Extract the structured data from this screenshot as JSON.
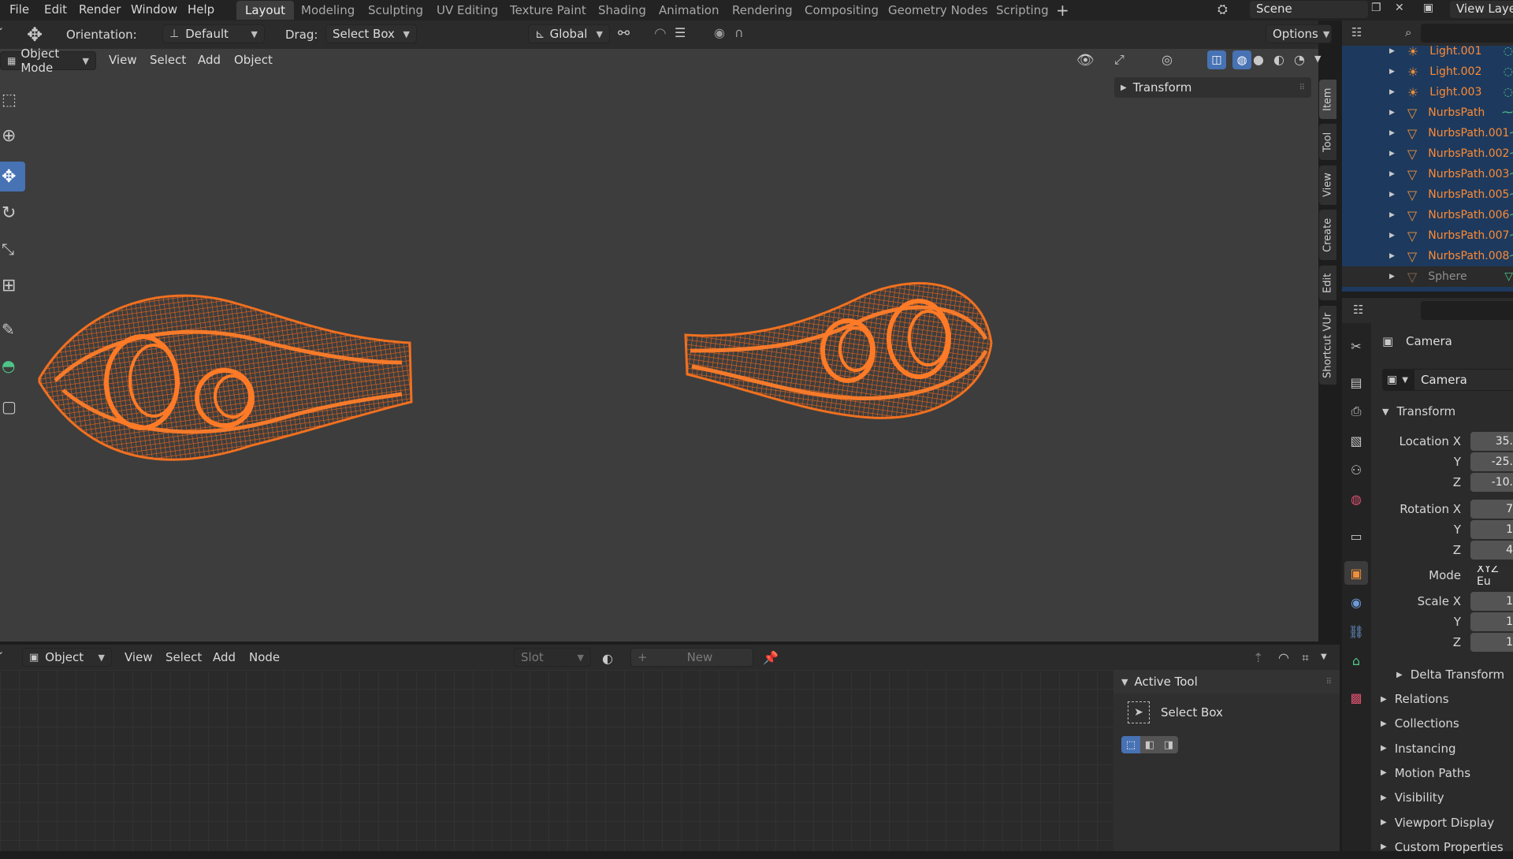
{
  "menu": [
    "File",
    "Edit",
    "Render",
    "Window",
    "Help"
  ],
  "workspaces": [
    "Layout",
    "Modeling",
    "Sculpting",
    "UV Editing",
    "Texture Paint",
    "Shading",
    "Animation",
    "Rendering",
    "Compositing",
    "Geometry Nodes",
    "Scripting"
  ],
  "active_workspace": "Layout",
  "scene_name": "Scene",
  "view_layer": "View Laye",
  "toolheader": {
    "orientation_label": "Orientation:",
    "orientation_value": "Default",
    "drag_label": "Drag:",
    "drag_value": "Select Box",
    "transform_orientation": "Global",
    "options": "Options"
  },
  "viewport_header": {
    "mode": "Object Mode",
    "menus": [
      "View",
      "Select",
      "Add",
      "Object"
    ]
  },
  "npanel": {
    "transform_header": "Transform",
    "tabs": [
      "Item",
      "Tool",
      "View",
      "Create",
      "Edit",
      "Shortcut VUr"
    ]
  },
  "outliner": {
    "rows": [
      {
        "name": "Light.001",
        "type": "light"
      },
      {
        "name": "Light.002",
        "type": "light"
      },
      {
        "name": "Light.003",
        "type": "light"
      },
      {
        "name": "NurbsPath",
        "type": "curve"
      },
      {
        "name": "NurbsPath.001",
        "type": "curve"
      },
      {
        "name": "NurbsPath.002",
        "type": "curve"
      },
      {
        "name": "NurbsPath.003",
        "type": "curve"
      },
      {
        "name": "NurbsPath.005",
        "type": "curve"
      },
      {
        "name": "NurbsPath.006",
        "type": "curve"
      },
      {
        "name": "NurbsPath.007",
        "type": "curve"
      },
      {
        "name": "NurbsPath.008",
        "type": "curve"
      },
      {
        "name": "Sphere",
        "type": "mesh"
      }
    ]
  },
  "properties": {
    "object_name": "Camera",
    "data_name": "Camera",
    "transform_header": "Transform",
    "location_label": "Location X",
    "location": [
      "35.",
      "-25.",
      "-10."
    ],
    "rotation_label": "Rotation X",
    "rotation": [
      "7",
      "1",
      "4"
    ],
    "mode_label": "Mode",
    "mode_value": "XYZ Eu",
    "scale_label": "Scale X",
    "scale": [
      "1",
      "1",
      "1"
    ],
    "axis_y": "Y",
    "axis_z": "Z",
    "delta_transform": "Delta Transform",
    "collapsed_panels": [
      "Relations",
      "Collections",
      "Instancing",
      "Motion Paths",
      "Visibility",
      "Viewport Display",
      "Custom Properties"
    ]
  },
  "node_editor": {
    "type": "Object",
    "menus": [
      "View",
      "Select",
      "Add",
      "Node"
    ],
    "slot": "Slot",
    "new_button": "New",
    "active_tool_header": "Active Tool",
    "active_tool_name": "Select Box"
  },
  "colors": {
    "accent_blue": "#4772b3",
    "wire_orange": "#e8641a",
    "outliner_highlight": "#1d3a5e",
    "selected_text": "#ff8a33"
  }
}
